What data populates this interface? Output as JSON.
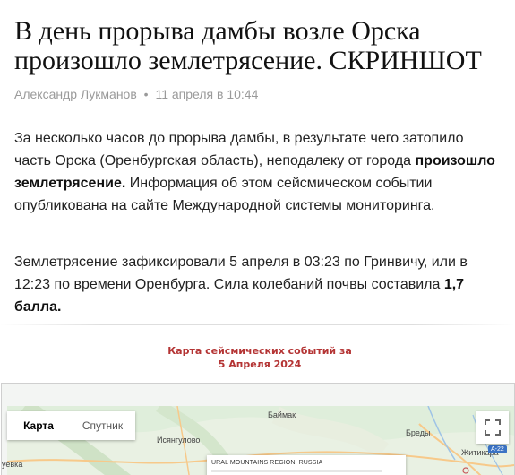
{
  "article": {
    "title": "В день прорыва дамбы возле Орска произошло землетрясение. СКРИНШОТ",
    "author": "Александр Лукманов",
    "separator": "•",
    "date": "11 апреля в 10:44",
    "p1_a": "За несколько часов до прорыва дамбы, в результате чего затопило часть Орска (Оренбургская область), неподалеку от города ",
    "p1_bold": "произошло землетрясение.",
    "p1_b": " Информация об этом сейсмическом событии опубликована на сайте Международной системы мониторинга.",
    "p2_a": "Землетрясение зафиксировали 5 апреля в 03:23 по Гринвичу, или в 12:23 по времени Оренбурга. Сила колебаний почвы составила ",
    "p2_bold": "1,7 балла."
  },
  "map": {
    "caption_line1": "Карта сейсмических событий за",
    "caption_line2": "5 Апреля 2024",
    "type_map": "Карта",
    "type_satellite": "Спутник",
    "info_title": "URAL MOUNTAINS REGION, RUSSIA",
    "labels": {
      "baymak": "Баймак",
      "isyangulovo": "Исянгулово",
      "bredy": "Бреды",
      "zhitikara": "Житикара",
      "left_cut": "уевка"
    },
    "road_badge": "А-22",
    "colors": {
      "caption": "#b43434",
      "map_land": "#dfeedb",
      "road": "#f7c98a"
    }
  }
}
